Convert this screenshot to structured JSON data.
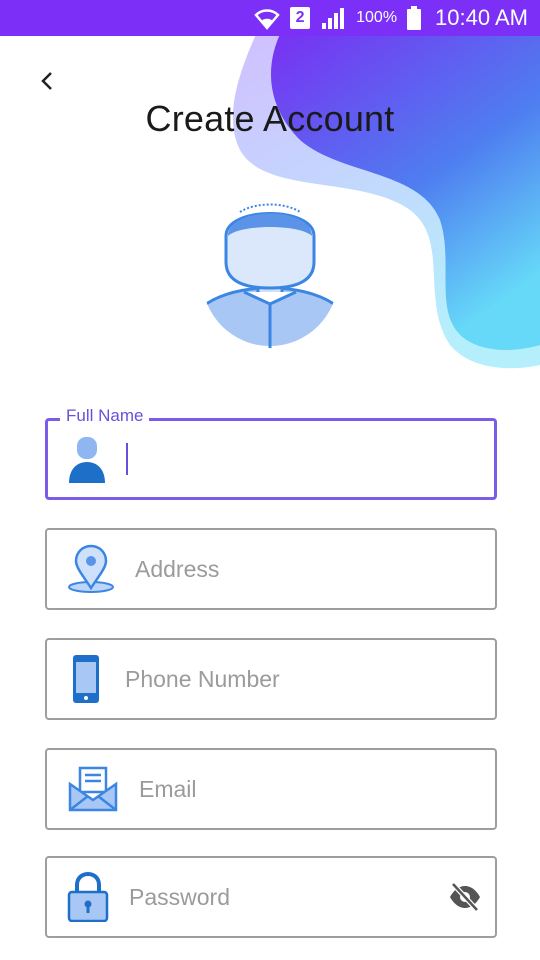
{
  "status_bar": {
    "sim_number": "2",
    "battery": "100%",
    "time": "10:40 AM"
  },
  "header": {
    "title": "Create Account"
  },
  "form": {
    "full_name": {
      "label": "Full Name",
      "value": ""
    },
    "address": {
      "placeholder": "Address",
      "value": ""
    },
    "phone": {
      "placeholder": "Phone Number",
      "value": ""
    },
    "email": {
      "placeholder": "Email",
      "value": ""
    },
    "password": {
      "placeholder": "Password",
      "value": ""
    }
  },
  "colors": {
    "status_bar": "#7b2ff7",
    "accent": "#7a5ce6",
    "field_border": "#9e9e9e",
    "icon_blue": "#3b86e3"
  },
  "icons": [
    "wifi-icon",
    "sim-icon",
    "signal-icon",
    "battery-icon",
    "back-arrow-icon",
    "avatar-icon",
    "person-icon",
    "location-pin-icon",
    "phone-icon",
    "email-icon",
    "lock-icon",
    "eye-off-icon"
  ]
}
